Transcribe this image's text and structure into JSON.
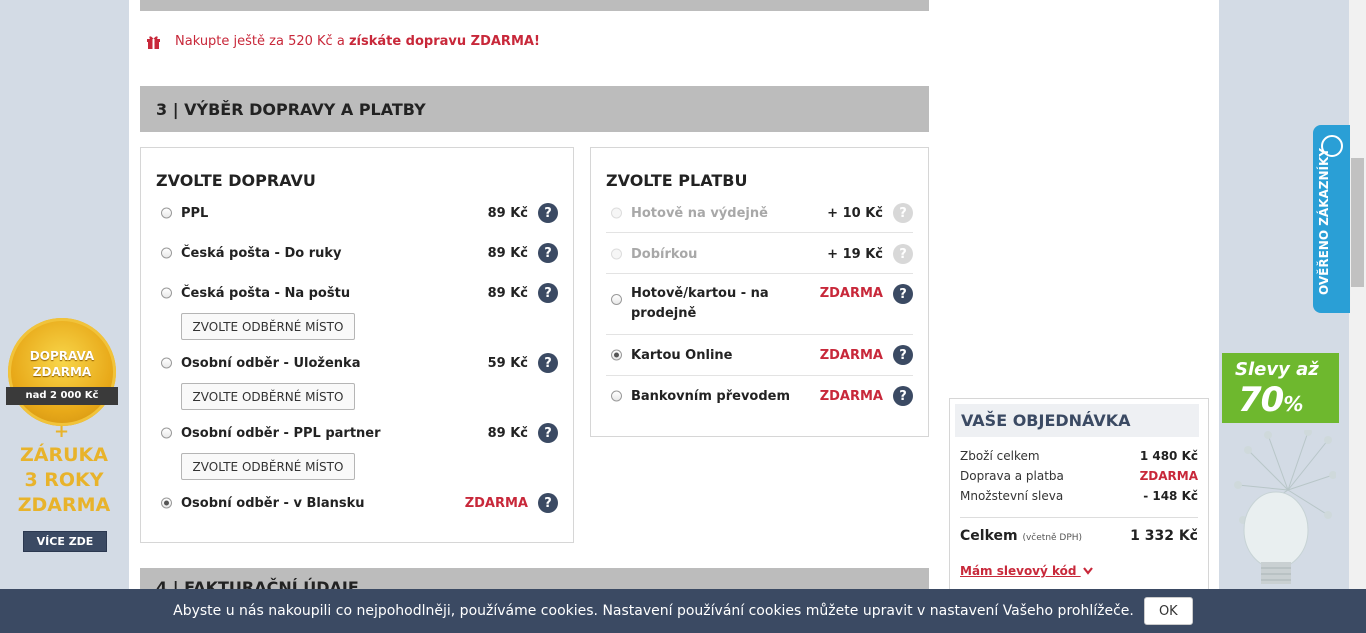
{
  "promo": {
    "text_prefix": "Nakupte ještě za 520 Kč a",
    "text_bold": "získáte dopravu ZDARMA!"
  },
  "section3": {
    "title": "3 | VÝBĚR DOPRAVY A PLATBY"
  },
  "section4": {
    "title": "4 | FAKTURAČNÍ ÚDAJE"
  },
  "shipping": {
    "heading": "ZVOLTE DOPRAVU",
    "pick_point_label": "ZVOLTE ODBĚRNÉ MÍSTO",
    "options": [
      {
        "label": "PPL",
        "price": "89 Kč"
      },
      {
        "label": "Česká pošta - Do ruky",
        "price": "89 Kč"
      },
      {
        "label": "Česká pošta - Na poštu",
        "price": "89 Kč"
      },
      {
        "label": "Osobní odběr - Uloženka",
        "price": "59 Kč"
      },
      {
        "label": "Osobní odběr - PPL partner",
        "price": "89 Kč"
      },
      {
        "label": "Osobní odběr - v Blansku",
        "price": "ZDARMA",
        "selected": true
      }
    ]
  },
  "payment": {
    "heading": "ZVOLTE PLATBU",
    "options": [
      {
        "label": "Hotově na výdejně",
        "price": "+ 10 Kč",
        "disabled": true
      },
      {
        "label": "Dobírkou",
        "price": "+ 19 Kč",
        "disabled": true
      },
      {
        "label": "Hotově/kartou - na prodejně",
        "label_line1": "Hotově/kartou - na",
        "label_line2": "prodejně",
        "price": "ZDARMA"
      },
      {
        "label": "Kartou Online",
        "price": "ZDARMA",
        "selected": true
      },
      {
        "label": "Bankovním převodem",
        "price": "ZDARMA"
      }
    ]
  },
  "order": {
    "heading": "VAŠE OBJEDNÁVKA",
    "lines": [
      {
        "label": "Zboží celkem",
        "value": "1 480 Kč"
      },
      {
        "label": "Doprava a platba",
        "value": "ZDARMA"
      },
      {
        "label": "Množstevní sleva",
        "value": "- 148 Kč"
      }
    ],
    "total_label": "Celkem",
    "total_note": "(včetně DPH)",
    "total_value": "1 332 Kč",
    "coupon_link": "Mám slevový kód"
  },
  "left_promo": {
    "badge_line1": "DOPRAVA",
    "badge_line2": "ZDARMA",
    "ribbon": "nad 2 000 Kč",
    "plus": "+",
    "zaruka_1": "ZÁRUKA",
    "zaruka_2": "3 ROKY",
    "zaruka_3": "ZDARMA",
    "more_button": "VÍCE ZDE"
  },
  "right_widgets": {
    "verified_label": "OVĚŘENO ZÁKAZNÍKY",
    "sale_line1": "Slevy až",
    "sale_line2": "70",
    "sale_pct": "%"
  },
  "cookie": {
    "text": "Abyste u nás nakoupili co nejpohodlněji, používáme cookies. Nastavení používání cookies můžete upravit v nastavení Vašeho prohlížeče.",
    "ok_label": "OK"
  },
  "colors": {
    "accent_red": "#c8283a",
    "navy": "#3b4a63",
    "section_gray": "#bcbcbc",
    "gold": "#e8b32b",
    "green": "#6eb82e",
    "verified_blue": "#2a9fd6"
  },
  "icons": [
    "gift-icon",
    "help-icon",
    "chevron-down-icon"
  ]
}
